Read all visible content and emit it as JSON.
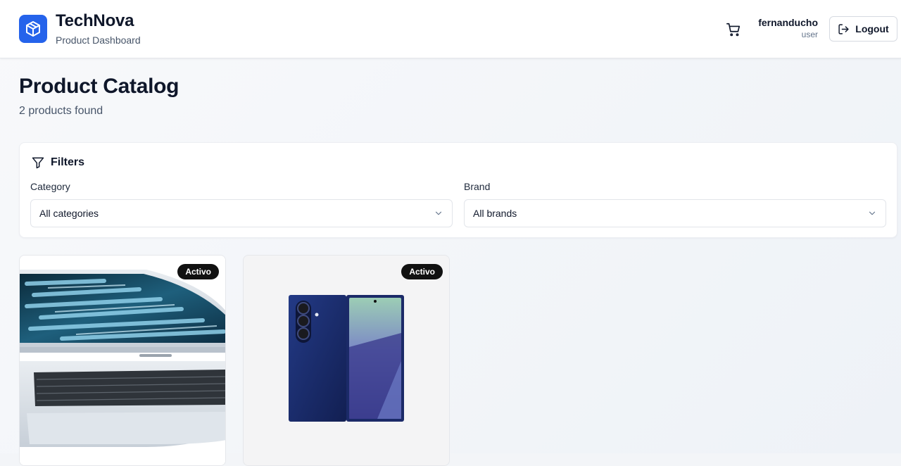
{
  "header": {
    "brand_name": "TechNova",
    "brand_subtitle": "Product Dashboard",
    "user_name": "fernanducho",
    "user_role": "user",
    "logout_label": "Logout",
    "icons": {
      "logo": "package-box-icon",
      "cart": "shopping-cart-icon",
      "logout": "logout-icon"
    }
  },
  "page": {
    "title": "Product Catalog",
    "result_count": "2 products found"
  },
  "filters": {
    "title": "Filters",
    "category_label": "Category",
    "category_value": "All categories",
    "brand_label": "Brand",
    "brand_value": "All brands"
  },
  "products": [
    {
      "badge": "Activo",
      "image": "laptop-photo"
    },
    {
      "badge": "Activo",
      "image": "foldable-phone-photo"
    }
  ],
  "colors": {
    "accent": "#2563eb",
    "badge_bg": "#111111",
    "text_primary": "#0f172a",
    "text_muted": "#475569"
  }
}
